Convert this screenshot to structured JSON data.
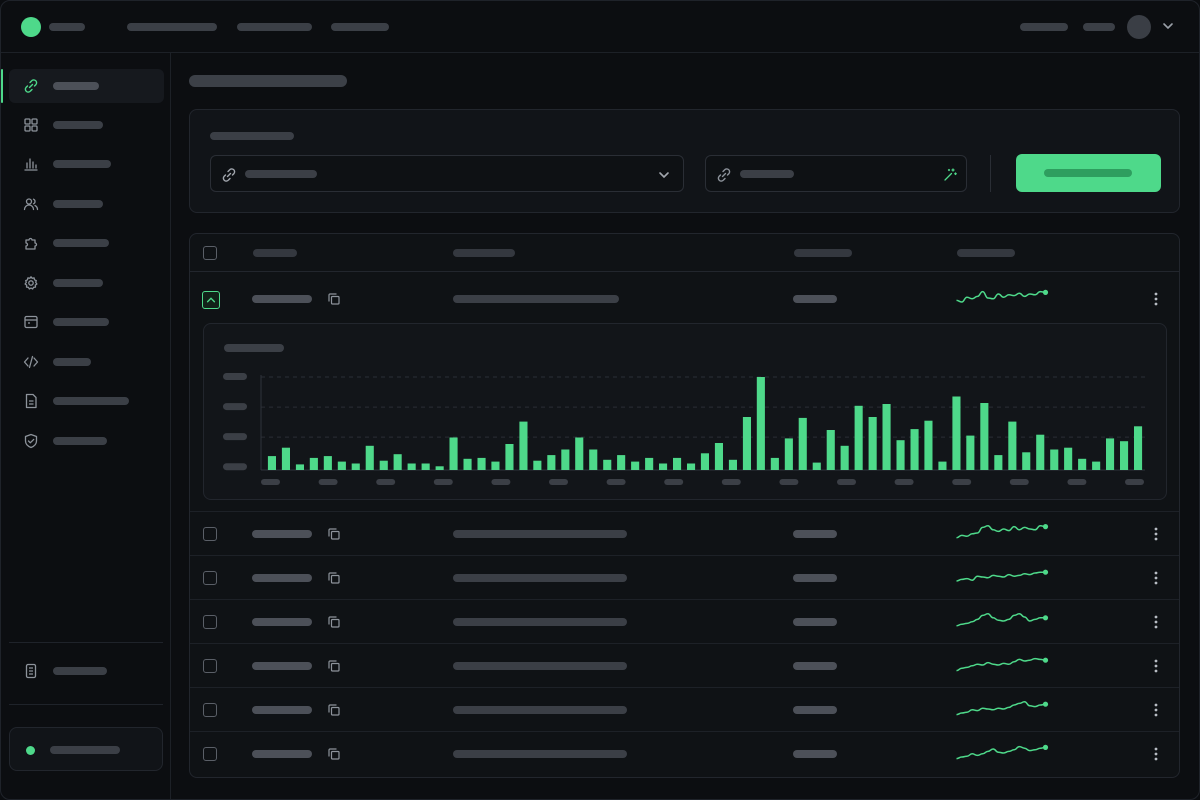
{
  "app": {
    "accent": "#4ed98a",
    "theme": "dark"
  },
  "topbar": {
    "nav_count": 3,
    "right_items": 2,
    "menu_icon": "chevron-down-icon"
  },
  "sidebar": {
    "items": [
      {
        "icon": "link-icon",
        "active": true
      },
      {
        "icon": "grid-icon"
      },
      {
        "icon": "bar-chart-icon"
      },
      {
        "icon": "users-icon"
      },
      {
        "icon": "puzzle-icon"
      },
      {
        "icon": "gear-icon"
      },
      {
        "icon": "window-icon"
      },
      {
        "icon": "code-icon"
      },
      {
        "icon": "document-icon"
      },
      {
        "icon": "shield-check-icon"
      }
    ],
    "footer_item": {
      "icon": "file-icon"
    },
    "status": {
      "color": "#4ed98a"
    }
  },
  "form": {
    "select_icon": "link-icon",
    "select_chevron": "chevron-down-icon",
    "input_icon": "link-icon",
    "input_action_icon": "magic-wand-icon"
  },
  "table": {
    "rows": [
      {
        "expanded": true,
        "sparkline": [
          0.35,
          0.25,
          0.55,
          0.45,
          0.6,
          0.9,
          0.5,
          0.45,
          0.75,
          0.55,
          0.7,
          0.65,
          0.8,
          0.6,
          0.75,
          0.7,
          0.9,
          0.85
        ]
      },
      {
        "expanded": false,
        "sparkline": [
          0.2,
          0.35,
          0.3,
          0.45,
          0.5,
          0.85,
          0.95,
          0.7,
          0.6,
          0.75,
          0.65,
          0.9,
          0.7,
          0.85,
          0.75,
          0.7,
          0.95,
          0.9
        ]
      },
      {
        "expanded": false,
        "sparkline": [
          0.25,
          0.35,
          0.4,
          0.3,
          0.55,
          0.5,
          0.45,
          0.6,
          0.55,
          0.5,
          0.65,
          0.55,
          0.6,
          0.7,
          0.65,
          0.75,
          0.8,
          0.8
        ]
      },
      {
        "expanded": false,
        "sparkline": [
          0.2,
          0.3,
          0.35,
          0.45,
          0.6,
          0.85,
          0.95,
          0.7,
          0.55,
          0.5,
          0.6,
          0.85,
          0.95,
          0.75,
          0.5,
          0.6,
          0.7,
          0.7
        ]
      },
      {
        "expanded": false,
        "sparkline": [
          0.15,
          0.3,
          0.35,
          0.45,
          0.55,
          0.5,
          0.65,
          0.55,
          0.5,
          0.6,
          0.55,
          0.7,
          0.85,
          0.75,
          0.8,
          0.9,
          0.85,
          0.8
        ]
      },
      {
        "expanded": false,
        "sparkline": [
          0.15,
          0.25,
          0.3,
          0.45,
          0.4,
          0.55,
          0.5,
          0.45,
          0.55,
          0.5,
          0.6,
          0.75,
          0.85,
          0.95,
          0.7,
          0.65,
          0.75,
          0.8
        ]
      },
      {
        "expanded": false,
        "sparkline": [
          0.15,
          0.25,
          0.3,
          0.45,
          0.35,
          0.45,
          0.6,
          0.75,
          0.55,
          0.5,
          0.6,
          0.7,
          0.9,
          0.8,
          0.65,
          0.7,
          0.8,
          0.85
        ]
      }
    ]
  },
  "chart_data": {
    "type": "bar",
    "values": [
      15,
      24,
      6,
      13,
      15,
      9,
      7,
      26,
      10,
      17,
      7,
      7,
      4,
      35,
      12,
      13,
      9,
      28,
      52,
      10,
      16,
      22,
      35,
      22,
      11,
      16,
      9,
      13,
      7,
      13,
      7,
      18,
      29,
      11,
      57,
      100,
      13,
      34,
      56,
      8,
      43,
      26,
      69,
      57,
      71,
      32,
      44,
      53,
      9,
      79,
      37,
      72,
      16,
      52,
      19,
      38,
      22,
      24,
      12,
      9,
      34,
      31,
      47
    ],
    "ylim": [
      0,
      100
    ],
    "grid": true,
    "color": "#4ed98a"
  }
}
